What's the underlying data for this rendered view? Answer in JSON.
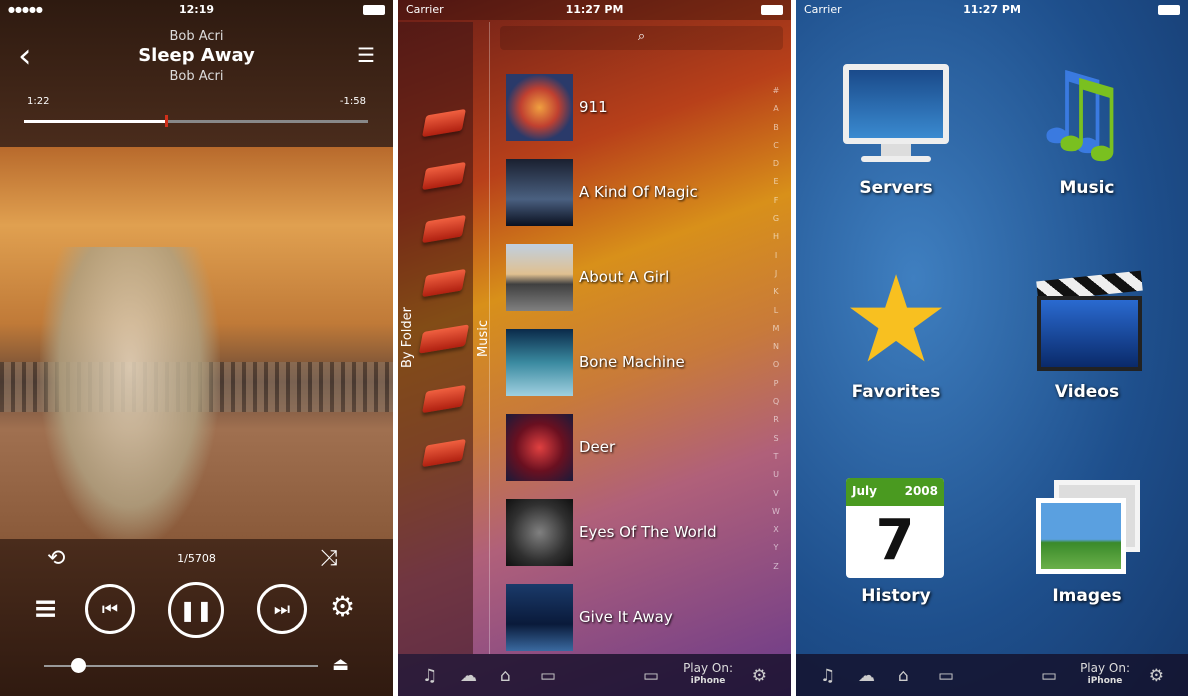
{
  "player": {
    "status": {
      "signal": "●●●●●",
      "time": "12:19"
    },
    "artist_top": "Bob Acri",
    "title": "Sleep Away",
    "artist_bottom": "Bob Acri",
    "elapsed": "1:22",
    "remaining": "-1:58",
    "progress": 0.41,
    "track_counter": "1/5708",
    "volume": 0.1,
    "icons": {
      "back": "‹",
      "queue": "☰",
      "repeat": "⟲",
      "shuffle": "⤨",
      "prev": "⏮",
      "pause": "❚❚",
      "next": "⏭",
      "playlist": "≡",
      "settings": "⚙",
      "airplay": "⏏"
    }
  },
  "library": {
    "status": {
      "carrier": "Carrier",
      "time": "11:27 PM"
    },
    "search_icon": "⌕",
    "tab_folder": "By Folder",
    "tab_music": "Music",
    "albums": [
      {
        "title": "911"
      },
      {
        "title": "A Kind Of Magic"
      },
      {
        "title": "About A Girl"
      },
      {
        "title": "Bone Machine"
      },
      {
        "title": "Deer"
      },
      {
        "title": "Eyes Of The World"
      },
      {
        "title": "Give It Away"
      }
    ],
    "index": [
      "#",
      "A",
      "B",
      "C",
      "D",
      "E",
      "F",
      "G",
      "H",
      "I",
      "J",
      "K",
      "L",
      "M",
      "N",
      "O",
      "P",
      "Q",
      "R",
      "S",
      "T",
      "U",
      "V",
      "W",
      "X",
      "Y",
      "Z"
    ],
    "toolbar": {
      "play_on": "Play On:",
      "device": "iPhone"
    }
  },
  "home": {
    "status": {
      "carrier": "Carrier",
      "time": "11:27 PM"
    },
    "tiles": [
      "Servers",
      "Music",
      "Favorites",
      "Videos",
      "History",
      "Images"
    ],
    "calendar": {
      "month": "July",
      "year": "2008",
      "day": "7"
    },
    "toolbar": {
      "play_on": "Play On:",
      "device": "iPhone"
    }
  }
}
